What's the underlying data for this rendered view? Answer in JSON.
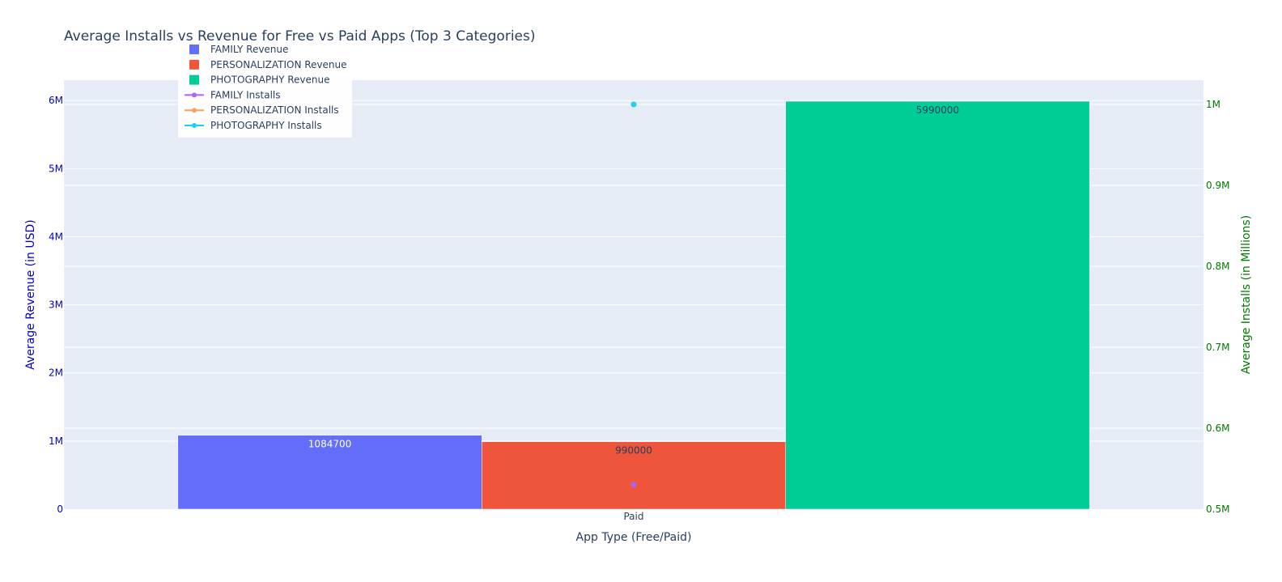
{
  "chart_data": {
    "type": "bar",
    "title": "Average Installs vs Revenue for Free vs Paid Apps (Top 3 Categories)",
    "xlabel": "App Type (Free/Paid)",
    "ylabel": "Average Revenue (in USD)",
    "y2label": "Average Installs (in Millions)",
    "categories": [
      "Paid"
    ],
    "ylim": [
      0,
      6300000
    ],
    "y2lim": [
      500000,
      1030000
    ],
    "yticks": [
      0,
      1000000,
      2000000,
      3000000,
      4000000,
      5000000,
      6000000
    ],
    "ytick_labels": [
      "0",
      "1M",
      "2M",
      "3M",
      "4M",
      "5M",
      "6M"
    ],
    "y2ticks": [
      500000,
      600000,
      700000,
      800000,
      900000,
      1000000
    ],
    "y2tick_labels": [
      "0.5M",
      "0.6M",
      "0.7M",
      "0.8M",
      "0.9M",
      "1M"
    ],
    "grid": true,
    "legend_position": "top-left",
    "bar_series": [
      {
        "name": "FAMILY Revenue",
        "values": [
          1084700
        ],
        "label": "1084700",
        "color": "#636efa"
      },
      {
        "name": "PERSONALIZATION Revenue",
        "values": [
          990000
        ],
        "label": "990000",
        "color": "#ef553b"
      },
      {
        "name": "PHOTOGRAPHY Revenue",
        "values": [
          5990000
        ],
        "label": "5990000",
        "color": "#00cc96"
      }
    ],
    "line_series": [
      {
        "name": "FAMILY Installs",
        "values": [
          530000
        ],
        "color": "#ab63fa"
      },
      {
        "name": "PERSONALIZATION Installs",
        "values": [
          null
        ],
        "color": "#ffa15a"
      },
      {
        "name": "PHOTOGRAPHY Installs",
        "values": [
          1000000
        ],
        "color": "#19d3f3"
      }
    ],
    "colors": {
      "plot_bg": "#e5ecf6",
      "grid": "#ffffff",
      "left_axis": "#0000cc",
      "right_axis": "#007a00",
      "text": "#2a3f5f"
    }
  }
}
